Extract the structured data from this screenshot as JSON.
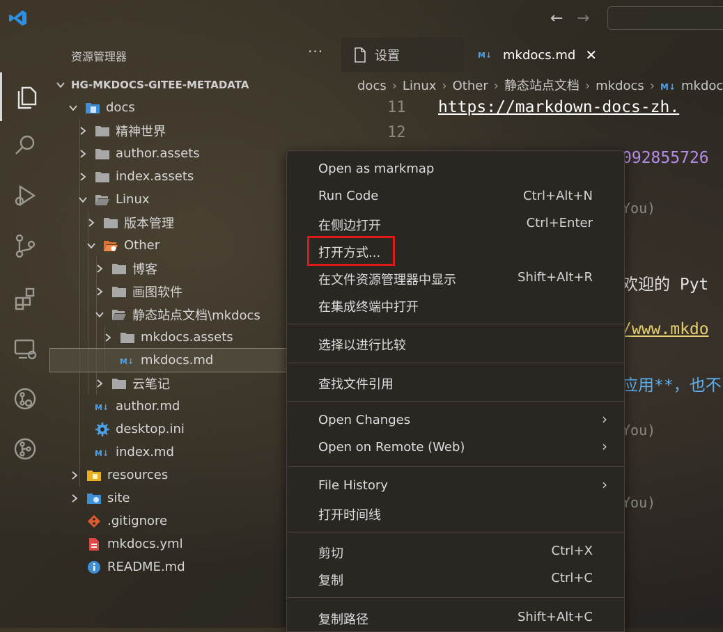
{
  "titlebar": {
    "back_icon": "arrow-left-icon",
    "forward_icon": "arrow-right-icon"
  },
  "sidebar": {
    "title": "资源管理器",
    "more": "···",
    "root": "HG-MKDOCS-GITEE-METADATA",
    "items": [
      {
        "label": "docs"
      },
      {
        "label": "精神世界"
      },
      {
        "label": "author.assets"
      },
      {
        "label": "index.assets"
      },
      {
        "label": "Linux"
      },
      {
        "label": "版本管理"
      },
      {
        "label": "Other"
      },
      {
        "label": "博客"
      },
      {
        "label": "画图软件"
      },
      {
        "label": "静态站点文档\\mkdocs"
      },
      {
        "label": "mkdocs.assets"
      },
      {
        "label": "mkdocs.md"
      },
      {
        "label": "云笔记"
      },
      {
        "label": "author.md"
      },
      {
        "label": "desktop.ini"
      },
      {
        "label": "index.md"
      },
      {
        "label": "resources"
      },
      {
        "label": "site"
      },
      {
        "label": ".gitignore"
      },
      {
        "label": "mkdocs.yml"
      },
      {
        "label": "README.md"
      }
    ]
  },
  "tabs": [
    {
      "label": "设置"
    },
    {
      "label": "mkdocs.md",
      "close": "✕"
    }
  ],
  "breadcrumb": [
    "docs",
    "Linux",
    "Other",
    "静态站点文档",
    "mkdocs",
    "mkdocs.md"
  ],
  "editor": {
    "line_numbers": [
      "11",
      "12"
    ],
    "line11": "https://markdown-docs-zh.",
    "frag_num": "092855726",
    "frag_you1": "You)",
    "frag_py": "欢迎的 Pyt",
    "frag_url": "/www.mkdo",
    "frag_app": "应用**，也不",
    "frag_you2": "You)",
    "frag_you3": "You)"
  },
  "context_menu": {
    "items": [
      {
        "label": "Open as markmap",
        "shortcut": ""
      },
      {
        "label": "Run Code",
        "shortcut": "Ctrl+Alt+N"
      },
      {
        "label": "在侧边打开",
        "shortcut": "Ctrl+Enter"
      },
      {
        "label": "打开方式...",
        "shortcut": ""
      },
      {
        "label": "在文件资源管理器中显示",
        "shortcut": "Shift+Alt+R"
      },
      {
        "label": "在集成终端中打开",
        "shortcut": ""
      },
      {
        "label": "选择以进行比较",
        "shortcut": ""
      },
      {
        "label": "查找文件引用",
        "shortcut": ""
      },
      {
        "label": "Open Changes",
        "shortcut": "",
        "submenu": true
      },
      {
        "label": "Open on Remote (Web)",
        "shortcut": "",
        "submenu": true
      },
      {
        "label": "File History",
        "shortcut": "",
        "submenu": true
      },
      {
        "label": "打开时间线",
        "shortcut": ""
      },
      {
        "label": "剪切",
        "shortcut": "Ctrl+X"
      },
      {
        "label": "复制",
        "shortcut": "Ctrl+C"
      },
      {
        "label": "复制路径",
        "shortcut": "Shift+Alt+C"
      }
    ]
  },
  "colors": {
    "folder": "#b0b0b0",
    "docs_folder": "#3e8fd8",
    "other_folder": "#e07030",
    "markdown_icon": "#4ea0e8",
    "highlight": "#e01818"
  }
}
